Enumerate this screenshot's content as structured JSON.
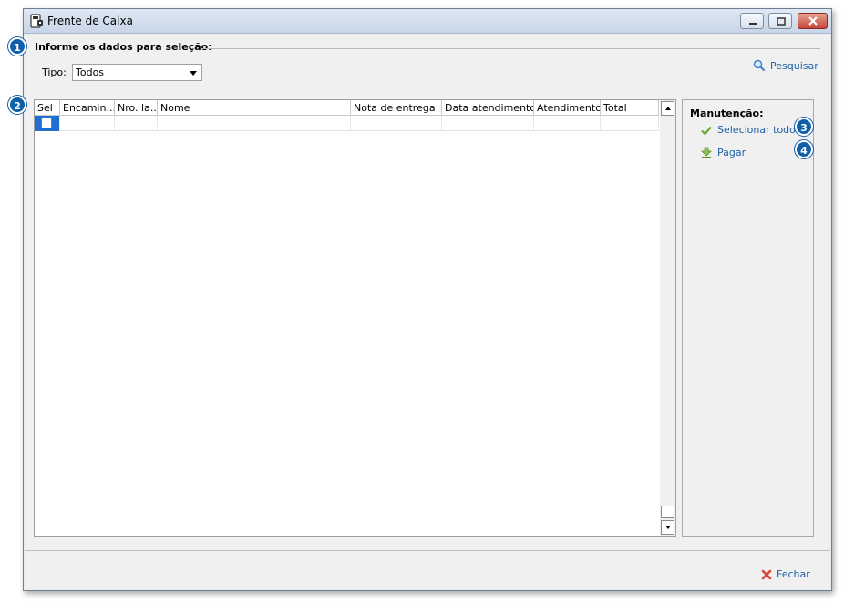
{
  "window": {
    "title": "Frente de Caixa"
  },
  "filter": {
    "section_title": "Informe os dados para seleção:",
    "tipo_label": "Tipo:",
    "tipo_value": "Todos",
    "search_label": "Pesquisar"
  },
  "grid": {
    "columns": [
      "Sel",
      "Encamin...",
      "Nro. la...",
      "Nome",
      "Nota de entrega",
      "Data atendimento",
      "Atendimento",
      "Total"
    ]
  },
  "panel": {
    "title": "Manutenção:",
    "select_all_label": "Selecionar todos",
    "pay_label": "Pagar"
  },
  "footer": {
    "close_label": "Fechar"
  },
  "callouts": [
    "1",
    "2",
    "3",
    "4"
  ],
  "colors": {
    "accent": "#1f5fa6",
    "callout": "#0f5fa9",
    "selection": "#1f6fd1"
  }
}
